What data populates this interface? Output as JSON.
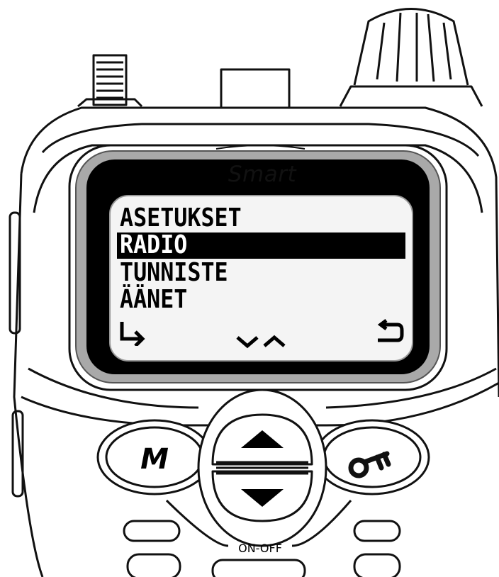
{
  "device": {
    "brand": "Smart",
    "power_label": "ON-OFF",
    "menu_key_label": "M"
  },
  "display": {
    "menu_items": [
      "ASETUKSET",
      "RADIO",
      "TUNNISTE",
      "ÄÄNET"
    ],
    "selected_index": 1,
    "softkeys": [
      "enter-arrow-icon",
      "down-up-arrows-icon",
      "back-arrow-icon"
    ]
  },
  "keys": [
    "menu-key",
    "up-key",
    "down-key",
    "key-lock-key"
  ],
  "colors": {
    "lcd_bg": "#f4f4f4",
    "highlight": "#000000",
    "outline": "#111111"
  }
}
